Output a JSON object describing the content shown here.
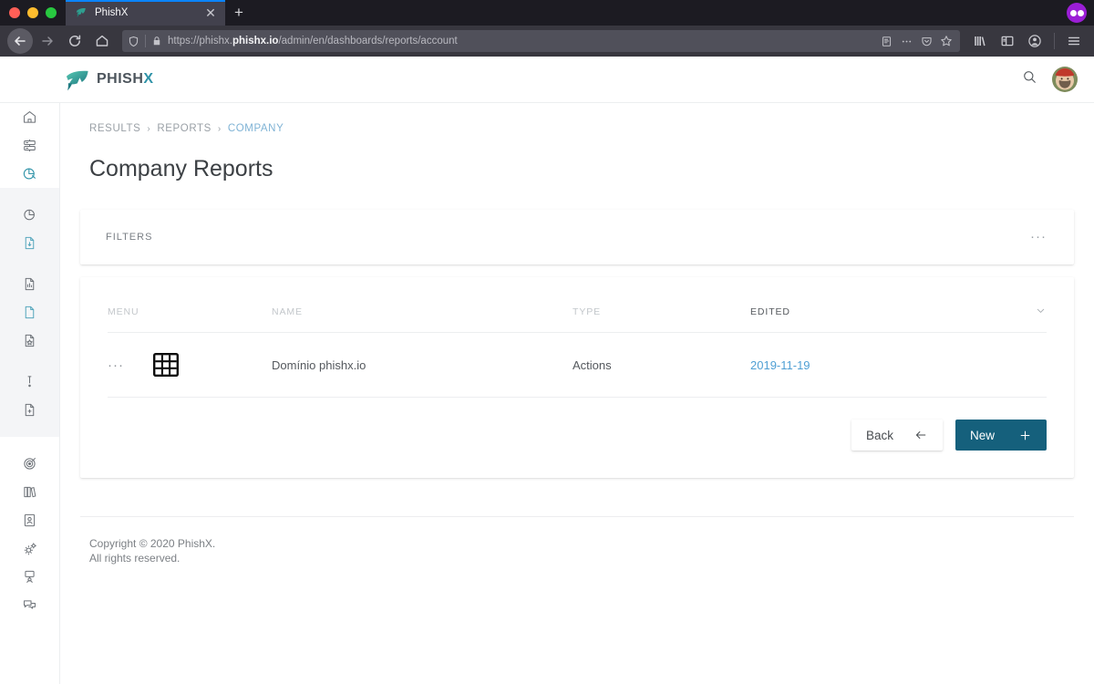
{
  "browser": {
    "tab": {
      "title": "PhishX",
      "favicon_icon": "fish-favicon",
      "close_icon": "close-icon"
    },
    "new_tab_label": "+",
    "nav": {
      "back_icon": "back-arrow-icon",
      "forward_icon": "forward-arrow-icon",
      "reload_icon": "reload-icon",
      "home_icon": "home-icon"
    },
    "url": {
      "shield_icon": "tracking-protection-shield-icon",
      "lock_icon": "padlock-icon",
      "prefix": "https://phishx.",
      "host_bold": "phishx.io",
      "path": "/admin/en/dashboards/reports/account",
      "full": "https://phishx.phishx.io/admin/en/dashboards/reports/account",
      "reader_icon": "reader-view-icon",
      "more_icon": "page-actions-ellipsis-icon",
      "pocket_icon": "pocket-icon",
      "bookmark_icon": "bookmark-star-icon"
    },
    "toolbar_right": {
      "library_icon": "library-icon",
      "sidebar_icon": "sidebar-icon",
      "account_icon": "account-icon",
      "menu_icon": "hamburger-menu-icon"
    },
    "recording_indicator_icon": "screen-recording-indicator-icon"
  },
  "header": {
    "logo_icon": "phishx-fish-logo-icon",
    "brand_first": "PHISH",
    "brand_accent": "X",
    "search_icon": "search-icon",
    "avatar_icon": "user-avatar"
  },
  "sidebar": {
    "groups": [
      {
        "shaded": false,
        "items": [
          {
            "icon": "home-icon",
            "accent": false
          },
          {
            "icon": "server-rack-icon",
            "accent": false
          },
          {
            "icon": "pie-chart-icon",
            "accent": true
          }
        ]
      },
      {
        "shaded": true,
        "items": [
          {
            "icon": "pie-chart-outline-icon",
            "accent": false
          },
          {
            "icon": "file-download-icon",
            "accent": true
          },
          {
            "icon": "spacer",
            "accent": false
          },
          {
            "icon": "file-chart-icon",
            "accent": false
          },
          {
            "icon": "file-blank-icon",
            "accent": true
          },
          {
            "icon": "file-star-icon",
            "accent": false
          },
          {
            "icon": "spacer",
            "accent": false
          },
          {
            "icon": "alert-exclamation-icon",
            "accent": false
          },
          {
            "icon": "file-add-icon",
            "accent": false
          }
        ]
      },
      {
        "shaded": false,
        "items": [
          {
            "icon": "target-radar-icon",
            "accent": false
          },
          {
            "icon": "books-library-icon",
            "accent": false
          },
          {
            "icon": "contact-card-icon",
            "accent": false
          },
          {
            "icon": "gears-settings-icon",
            "accent": false
          },
          {
            "icon": "presenter-user-icon",
            "accent": false
          },
          {
            "icon": "chat-bubbles-icon",
            "accent": false
          }
        ]
      }
    ]
  },
  "breadcrumb": {
    "items": [
      "RESULTS",
      "REPORTS",
      "COMPANY"
    ],
    "separator": "›",
    "current_index": 2
  },
  "page": {
    "title": "Company Reports"
  },
  "filters": {
    "label": "FILTERS",
    "more_icon": "ellipsis-icon",
    "more_label": "···"
  },
  "table": {
    "columns": [
      {
        "key": "menu",
        "label": "MENU",
        "active": false
      },
      {
        "key": "icon",
        "label": "",
        "active": false
      },
      {
        "key": "name",
        "label": "NAME",
        "active": false
      },
      {
        "key": "type",
        "label": "TYPE",
        "active": false
      },
      {
        "key": "edited",
        "label": "EDITED",
        "active": true
      }
    ],
    "sort_icon": "chevron-down-icon",
    "rows": [
      {
        "menu_label": "···",
        "menu_icon": "row-menu-ellipsis-icon",
        "type_icon": "grid-table-icon",
        "name": "Domínio phishx.io",
        "type": "Actions",
        "edited": "2019-11-19"
      }
    ]
  },
  "actions": {
    "back": {
      "label": "Back",
      "icon": "arrow-left-icon",
      "glyph": "←"
    },
    "new": {
      "label": "New",
      "icon": "plus-icon",
      "glyph": "+"
    }
  },
  "footer": {
    "line1": "Copyright © 2020 PhishX.",
    "line2": "All rights reserved."
  },
  "colors": {
    "accent_teal": "#2f93a8",
    "button_primary": "#15607c",
    "link_blue": "#4f9fd4",
    "breadcrumb_current": "#7fb3d5",
    "chrome_dark": "#38373f",
    "tab_active_border": "#0a84ff"
  }
}
